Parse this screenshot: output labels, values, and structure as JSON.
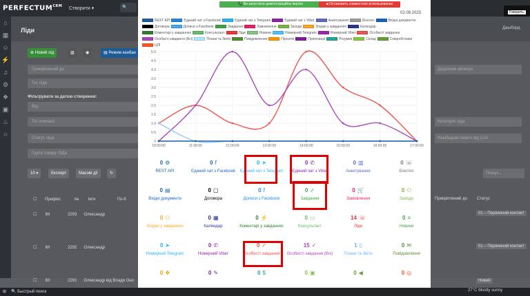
{
  "app": {
    "logo": "PERFECTUM",
    "logo_sup": "CRM",
    "nav_create": "Створити",
    "notif": "Говорить:"
  },
  "page": {
    "title": "Ліди",
    "crumb": "Дашборд"
  },
  "filters": {
    "new_lead": "Новий лід",
    "kanban": "Режим канбан",
    "field1": "Прикріплений до",
    "field2": "Тег ліда",
    "created_label": "Фільтрувати за датою створення:",
    "from": "Від",
    "company": "Тег компанії",
    "status": "Статус ліда",
    "group": "Група товару ЛІДа",
    "page_size": "10",
    "export": "Експорт",
    "bulk": "Масові дії"
  },
  "right_filters": {
    "extra": "Додаткові фільтри",
    "cat": "Категорія ліда",
    "unmapped": "Нанібадові пакети від LUA",
    "search": "Пошук..."
  },
  "table": {
    "headers": [
      "Префікс",
      "№",
      "Ім'я",
      "По-б",
      "Прикріплений до",
      "Статус"
    ],
    "rows": [
      {
        "prefix": "ІМ",
        "num": "2293",
        "name": "Олександр",
        "status": "01 – Первинний контакт"
      },
      {
        "prefix": "ІМ",
        "num": "2292",
        "name": "Олександр",
        "status": "01 – Первинний контакт"
      },
      {
        "prefix": "ІМ",
        "num": "2291",
        "name": "Олександр від Влади Оно",
        "status": "Новий"
      }
    ]
  },
  "modal": {
    "banner_green": "Ви запустили демонстраційну версію",
    "banner_red": "Остановить совместное использование",
    "date": "02.09.2025"
  },
  "legend": [
    {
      "label": "REST API",
      "color": "#1f5fa0"
    },
    {
      "label": "Єдиний чат з Facebook",
      "color": "#1e88e5"
    },
    {
      "label": "Єдиний чат з Telegram",
      "color": "#29b6f6"
    },
    {
      "label": "Єдиний чат з Viber",
      "color": "#8e24aa"
    },
    {
      "label": "Анкетування",
      "color": "#5c6bc0"
    },
    {
      "label": "Бінотел",
      "color": "#9e9e9e"
    },
    {
      "label": "Вхідні документи",
      "color": "#1565c0"
    },
    {
      "label": "Договора",
      "color": "#000000"
    },
    {
      "label": "Дописи з Facebook",
      "color": "#42a5f5"
    },
    {
      "label": "Завдання",
      "color": "#43a047"
    },
    {
      "label": "Замовлення",
      "color": "#e91e63"
    },
    {
      "label": "Заходи",
      "color": "#7cb342"
    },
    {
      "label": "Згадки у завданнях",
      "color": "#f9a825"
    },
    {
      "label": "Календар",
      "color": "#283593"
    },
    {
      "label": "Коментарі у завданнях",
      "color": "#2e7d32"
    },
    {
      "label": "Консультант",
      "color": "#66bb6a"
    },
    {
      "label": "Ліди",
      "color": "#e53935"
    },
    {
      "label": "Новини",
      "color": "#81c784"
    },
    {
      "label": "Номерний Telegram",
      "color": "#4fc3f7"
    },
    {
      "label": "Номерний Viber",
      "color": "#9c27b0"
    },
    {
      "label": "Особисті завдання",
      "color": "#ef5350"
    },
    {
      "label": "Особисті завдання (Всі)",
      "color": "#ab47bc"
    },
    {
      "label": "Плани та Звіти",
      "color": "#b3e5fc"
    },
    {
      "label": "Повідомлення",
      "color": "#558b2f"
    },
    {
      "label": "Проєкти",
      "color": "#ff9800"
    },
    {
      "label": "Пропозиції",
      "color": "#7b1fa2"
    },
    {
      "label": "Розумки",
      "color": "#26a69a"
    },
    {
      "label": "Склад",
      "color": "#8bc34a"
    },
    {
      "label": "Співробітники",
      "color": "#689f38"
    },
    {
      "label": "ЦЛІ",
      "color": "#ff5722"
    }
  ],
  "chart_data": {
    "type": "line",
    "x": [
      "10:00:00",
      "11:00:00",
      "12:00:00",
      "13:00:00",
      "14:00:00",
      "15:00:00",
      "16:00:00",
      "17:00:00"
    ],
    "ylim": [
      0,
      5
    ],
    "yticks": [
      "0",
      "0.5",
      "1.0",
      "1.5",
      "2.0",
      "2.5",
      "3.0",
      "3.5",
      "4.0",
      "4.5",
      "5.0"
    ],
    "series": [
      {
        "name": "Особисті завдання",
        "color": "#ef5350",
        "values": [
          1,
          2,
          1,
          1,
          5,
          3,
          2,
          0
        ]
      },
      {
        "name": "Особисті завдання (Всі)",
        "color": "#ab47bc",
        "values": [
          0,
          2,
          5,
          2,
          4,
          1,
          1,
          0
        ]
      },
      {
        "name": "Плани та Звіти",
        "color": "#90caf9",
        "values": [
          1,
          0,
          0,
          0,
          0,
          0,
          0,
          0
        ]
      },
      {
        "name": "REST API",
        "color": "#1f5fa0",
        "values": [
          0,
          0,
          0,
          0,
          0,
          0,
          0,
          0
        ]
      }
    ]
  },
  "stats": [
    {
      "value": "0",
      "icon": "⚙",
      "label": "REST API",
      "color": "#1f5fa0",
      "icon_name": "gear-icon"
    },
    {
      "value": "0",
      "icon": "f",
      "label": "Єдиний чат з Facebook",
      "color": "#1565c0",
      "icon_name": "facebook-icon"
    },
    {
      "value": "0",
      "icon": "➤",
      "label": "Єдиний чат з Telegram",
      "color": "#29b6f6",
      "icon_name": "telegram-icon"
    },
    {
      "value": "0",
      "icon": "✆",
      "label": "Єдиний чат з Viber",
      "color": "#8e24aa",
      "icon_name": "viber-icon"
    },
    {
      "value": "0",
      "icon": "▥",
      "label": "Анкетування",
      "color": "#5c6bc0",
      "icon_name": "survey-icon"
    },
    {
      "value": "0",
      "icon": "☏",
      "label": "Бінотел",
      "color": "#757575",
      "icon_name": "phone-icon"
    },
    {
      "value": "0",
      "icon": "▤",
      "label": "Вхідні документи",
      "color": "#1565c0",
      "icon_name": "inbox-icon"
    },
    {
      "value": "0",
      "icon": "▢",
      "label": "Договора",
      "color": "#000000",
      "icon_name": "document-icon"
    },
    {
      "value": "0",
      "icon": "f",
      "label": "Дописи з Facebook",
      "color": "#1e88e5",
      "icon_name": "facebook-post-icon"
    },
    {
      "value": "0",
      "icon": "✓",
      "label": "Завдання",
      "color": "#43a047",
      "icon_name": "task-icon"
    },
    {
      "value": "0",
      "icon": "🛒",
      "label": "Замовлення",
      "color": "#e91e63",
      "icon_name": "cart-icon"
    },
    {
      "value": "0",
      "icon": "⚇",
      "label": "Заходи",
      "color": "#7cb342",
      "icon_name": "people-icon"
    },
    {
      "value": "0",
      "icon": "⚇",
      "label": "Згадки у завданнях",
      "color": "#f9a825",
      "icon_name": "mention-icon"
    },
    {
      "value": "0",
      "icon": "▦",
      "label": "Календар",
      "color": "#283593",
      "icon_name": "calendar-icon"
    },
    {
      "value": "0",
      "icon": "⚡",
      "label": "Коментарі у завданнях",
      "color": "#2e7d32",
      "icon_name": "comment-icon"
    },
    {
      "value": "0",
      "icon": "▭",
      "label": "Консультант",
      "color": "#66bb6a",
      "icon_name": "consultant-icon"
    },
    {
      "value": "14",
      "icon": "☏",
      "label": "Ліди",
      "color": "#e53935",
      "icon_name": "lead-icon"
    },
    {
      "value": "0",
      "icon": "≡",
      "label": "Новини",
      "color": "#43a047",
      "icon_name": "news-icon"
    },
    {
      "value": "0",
      "icon": "➤",
      "label": "Номерний Telegram",
      "color": "#29b6f6",
      "icon_name": "telegram-number-icon"
    },
    {
      "value": "0",
      "icon": "✆",
      "label": "Номерний Viber",
      "color": "#8e24aa",
      "icon_name": "viber-number-icon"
    },
    {
      "value": "0",
      "icon": "✓",
      "label": "Особисті завдання",
      "color": "#ef5350",
      "icon_name": "personal-task-icon"
    },
    {
      "value": "15",
      "icon": "✓",
      "label": "Особисті завдання (Всі)",
      "color": "#ab47bc",
      "icon_name": "personal-task-all-icon"
    },
    {
      "value": "1",
      "icon": "▯",
      "label": "Плани та Звіти",
      "color": "#64b5f6",
      "icon_name": "plan-icon"
    },
    {
      "value": "0",
      "icon": "✉",
      "label": "Повідомлення",
      "color": "#558b2f",
      "icon_name": "message-icon"
    },
    {
      "value": "0",
      "icon": "❖",
      "label": "",
      "color": "#ff9800",
      "icon_name": "layers-icon"
    },
    {
      "value": "0",
      "icon": "✎",
      "label": "",
      "color": "#7b1fa2",
      "icon_name": "pen-icon"
    },
    {
      "value": "0",
      "icon": "$",
      "label": "",
      "color": "#26a69a",
      "icon_name": "dollar-icon"
    },
    {
      "value": "0",
      "icon": "▣",
      "label": "",
      "color": "#8bc34a",
      "icon_name": "storage-icon"
    },
    {
      "value": "0",
      "icon": "◀",
      "label": "",
      "color": "#689f38",
      "icon_name": "speaker-icon"
    },
    {
      "value": "0",
      "icon": "◎",
      "label": "",
      "color": "#ff5722",
      "icon_name": "target-icon"
    }
  ],
  "taskbar": {
    "search": "Быстрый поиск",
    "weather": "27°C Mostly sunny"
  }
}
